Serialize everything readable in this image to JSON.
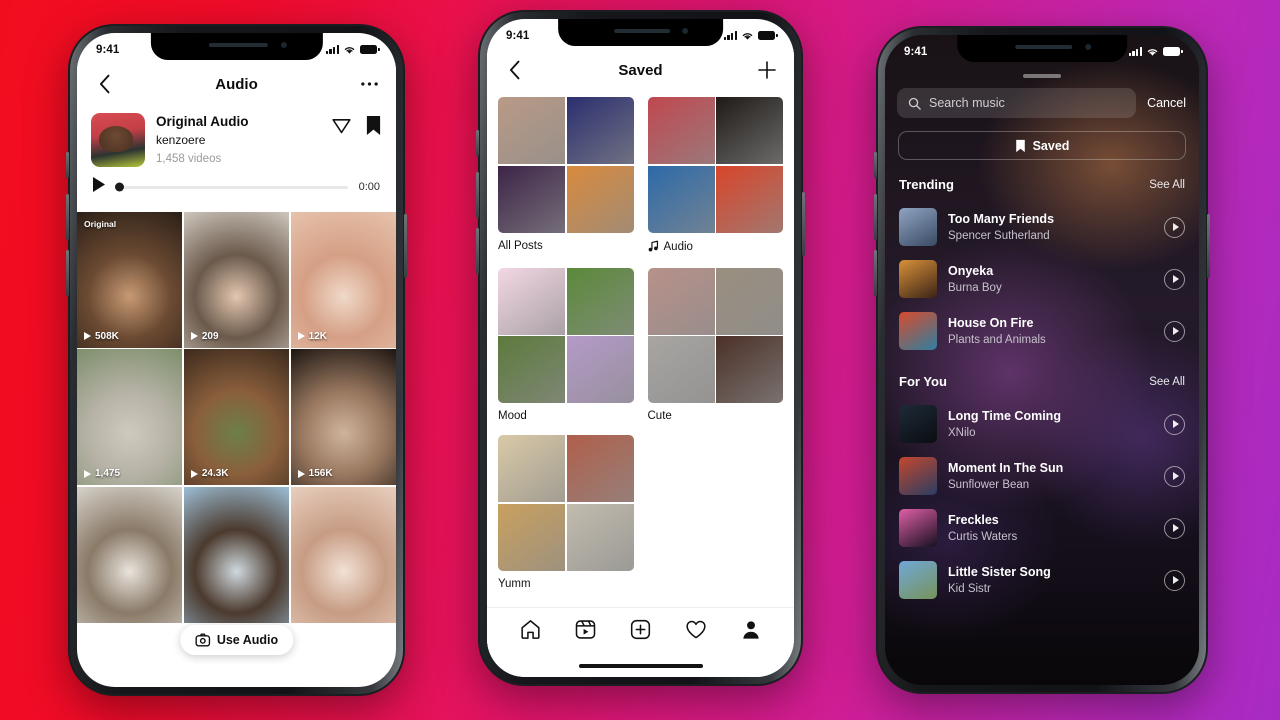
{
  "background": {
    "from": "#f20d1e",
    "mid": "#dd1570",
    "to": "#a62bc4"
  },
  "phone1": {
    "status": {
      "time": "9:41",
      "signal_icon": "cellular-bars-icon",
      "wifi_icon": "wifi-icon",
      "battery_icon": "battery-icon"
    },
    "nav": {
      "back_icon": "chevron-left-icon",
      "title": "Audio",
      "more_icon": "more-options-icon"
    },
    "audio": {
      "title": "Original Audio",
      "username": "kenzoere",
      "video_count": "1,458 videos",
      "share_icon": "share-paper-plane-icon",
      "save_icon": "bookmark-filled-icon",
      "play_icon": "play-icon",
      "elapsed": "0:00"
    },
    "use_audio_label": "Use Audio",
    "camera_icon": "camera-icon",
    "grid": [
      {
        "badge": "Original",
        "views": "508K",
        "c1": "#2b1f17",
        "c2": "#6b4a32",
        "c3": "#c79a74"
      },
      {
        "badge": "",
        "views": "209",
        "c1": "#cfc7bd",
        "c2": "#6b5a4c",
        "c3": "#e3c7b0"
      },
      {
        "badge": "",
        "views": "12K",
        "c1": "#e6c3ac",
        "c2": "#d59f85",
        "c3": "#f0d9c8"
      },
      {
        "badge": "",
        "views": "1,475",
        "c1": "#7d8f6a",
        "c2": "#b6b2a6",
        "c3": "#cfcabd"
      },
      {
        "badge": "",
        "views": "24.3K",
        "c1": "#3c2a1d",
        "c2": "#8a5f3c",
        "c3": "#6d7f4a"
      },
      {
        "badge": "",
        "views": "156K",
        "c1": "#1b1511",
        "c2": "#9a7860",
        "c3": "#cfb49c"
      },
      {
        "badge": "",
        "views": "",
        "c1": "#d7d3cb",
        "c2": "#8a7a68",
        "c3": "#e9e4dc"
      },
      {
        "badge": "",
        "views": "",
        "c1": "#9dbfd6",
        "c2": "#4b3a2e",
        "c3": "#cfd9de"
      },
      {
        "badge": "",
        "views": "",
        "c1": "#e8cfbe",
        "c2": "#c79c84",
        "c3": "#f2e1d4"
      }
    ]
  },
  "phone2": {
    "status": {
      "time": "9:41"
    },
    "nav": {
      "back_icon": "chevron-left-icon",
      "title": "Saved",
      "add_icon": "plus-icon"
    },
    "collections": [
      {
        "label": "All Posts",
        "has_music_icon": false,
        "tiles": [
          "#b99a86",
          "#2b2f6e",
          "#3d2448",
          "#d98a3d"
        ]
      },
      {
        "label": "Audio",
        "has_music_icon": true,
        "music_icon": "music-note-icon",
        "tiles": [
          "#c0484f",
          "#1e1a17",
          "#2d6aa8",
          "#d8452a"
        ]
      },
      {
        "label": "Mood",
        "has_music_icon": false,
        "tiles": [
          "#f3d7e4",
          "#5b8a3a",
          "#5d7a3c",
          "#b49ac8"
        ]
      },
      {
        "label": "Cute",
        "has_music_icon": false,
        "tiles": [
          "#b8918a",
          "#9a8f80",
          "#a8a5a2",
          "#4b3027"
        ]
      },
      {
        "label": "Yumm",
        "has_music_icon": false,
        "tiles": [
          "#d9c9a6",
          "#b05f4a",
          "#c9a05e",
          "#c2bcae"
        ]
      }
    ],
    "tabs": [
      {
        "name": "home",
        "icon": "home-icon"
      },
      {
        "name": "reels",
        "icon": "reels-icon"
      },
      {
        "name": "create",
        "icon": "plus-square-icon"
      },
      {
        "name": "activity",
        "icon": "heart-icon"
      },
      {
        "name": "profile",
        "icon": "profile-avatar-icon"
      }
    ]
  },
  "phone3": {
    "status": {
      "time": "9:41"
    },
    "search": {
      "placeholder": "Search music",
      "icon": "search-icon"
    },
    "cancel_label": "Cancel",
    "saved_button": {
      "label": "Saved",
      "icon": "bookmark-filled-icon"
    },
    "sections": [
      {
        "title": "Trending",
        "see_all": "See All",
        "tracks": [
          {
            "name": "Too Many Friends",
            "artist": "Spencer Sutherland",
            "play_icon": "play-circle-icon",
            "c1": "#8fa4c2",
            "c2": "#3a4a63"
          },
          {
            "name": "Onyeka",
            "artist": "Burna Boy",
            "play_icon": "play-circle-icon",
            "c1": "#d9913a",
            "c2": "#3b2416"
          },
          {
            "name": "House On Fire",
            "artist": "Plants and Animals",
            "play_icon": "play-circle-icon",
            "c1": "#d84b2e",
            "c2": "#2f7fa0"
          }
        ]
      },
      {
        "title": "For You",
        "see_all": "See All",
        "tracks": [
          {
            "name": "Long Time Coming",
            "artist": "XNilo",
            "play_icon": "play-circle-icon",
            "c1": "#1d2a38",
            "c2": "#0b0d11"
          },
          {
            "name": "Moment In The Sun",
            "artist": "Sunflower Bean",
            "play_icon": "play-circle-icon",
            "c1": "#c4472d",
            "c2": "#2b3d63"
          },
          {
            "name": "Freckles",
            "artist": "Curtis Waters",
            "play_icon": "play-circle-icon",
            "c1": "#e05fa8",
            "c2": "#16101f"
          },
          {
            "name": "Little Sister Song",
            "artist": "Kid Sistr",
            "play_icon": "play-circle-icon",
            "c1": "#6fa8d8",
            "c2": "#77935a"
          }
        ]
      }
    ]
  }
}
